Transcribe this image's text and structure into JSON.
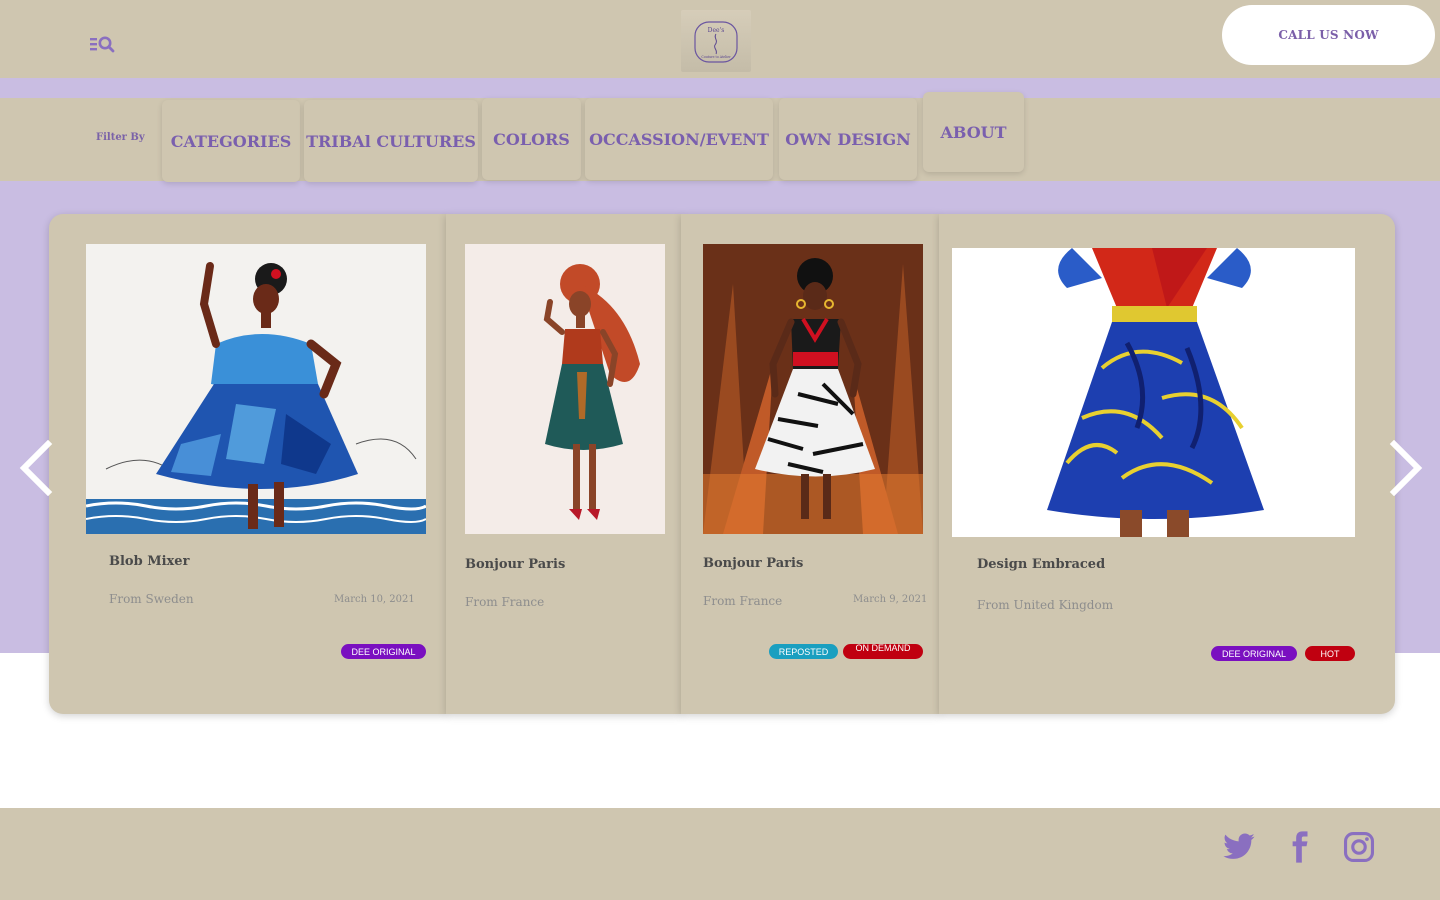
{
  "header": {
    "call_button": "CALL US NOW",
    "logo_text_top": "Dee's",
    "logo_text_bottom": "Couture to Atelier"
  },
  "filters": {
    "label": "Filter By",
    "chips": [
      "CATEGORIES",
      "TRIBAl CULTURES",
      "COLORS",
      "OCCASSION/EVENT",
      "OWN DESIGN",
      "ABOUT"
    ]
  },
  "cards": [
    {
      "title": "Blob Mixer",
      "origin": "From Sweden",
      "date": "March 10, 2021",
      "badges": [
        "DEE ORIGINAL"
      ]
    },
    {
      "title": "Bonjour Paris",
      "origin": "From France",
      "date": "",
      "badges": []
    },
    {
      "title": "Bonjour Paris",
      "origin": "From France",
      "date": "March 9, 2021",
      "badges": [
        "REPOSTED",
        "ON DEMAND"
      ]
    },
    {
      "title": "Design Embraced",
      "origin": "From United Kingdom",
      "date": "",
      "badges": [
        "DEE ORIGINAL",
        "HOT"
      ]
    }
  ],
  "icons": {
    "menu": "menu-search-icon",
    "prev": "chevron-left-icon",
    "next": "chevron-right-icon",
    "social": [
      "twitter-icon",
      "facebook-icon",
      "instagram-icon"
    ]
  },
  "colors": {
    "beige": "#cfc6b0",
    "lavender": "#c9bde2",
    "purple_text": "#7a5fae",
    "badge_purple": "#7a0fc0",
    "badge_teal": "#1a9fc0",
    "badge_red": "#c00010"
  }
}
